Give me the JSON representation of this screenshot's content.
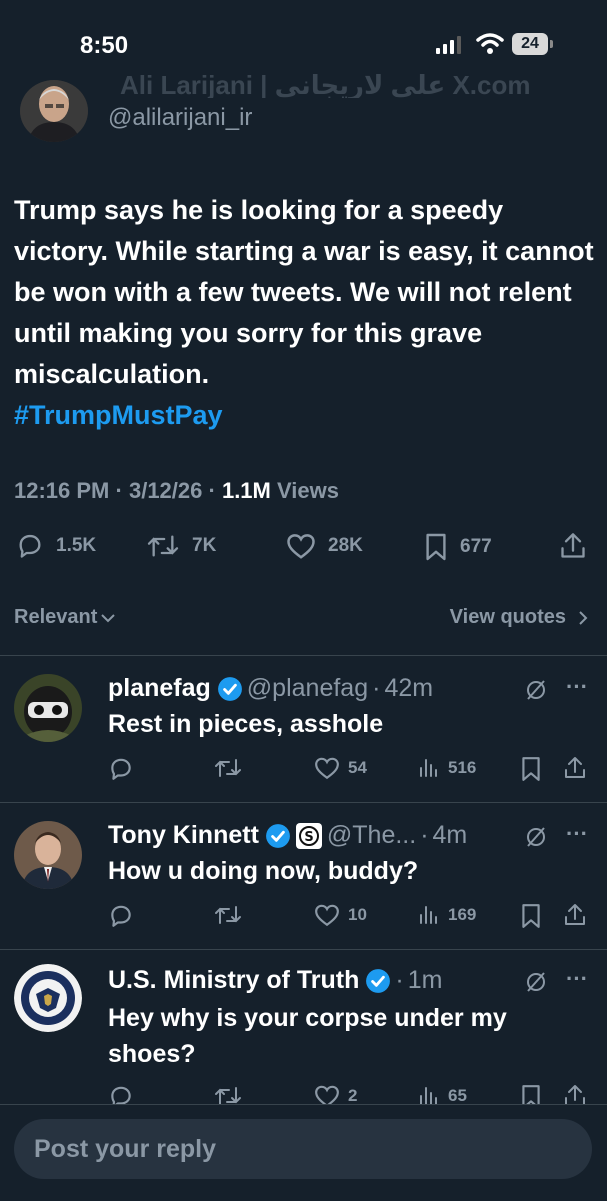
{
  "status_bar": {
    "time": "8:50",
    "battery": "24"
  },
  "header": {
    "ghost_text": "Ali Larijani | علی لاریجانی    X.com"
  },
  "tweet": {
    "handle": "@alilarijani_ir",
    "text": "Trump says he is looking for a speedy victory. While starting a war is easy, it cannot be won with a few tweets. We will not relent until making you sorry for this grave miscalculation.",
    "hashtag": "#TrumpMustPay",
    "time": "12:16 PM",
    "date": "3/12/26",
    "views_count": "1.1M",
    "views_label": "Views",
    "replies": "1.5K",
    "reposts": "7K",
    "likes": "28K",
    "bookmarks": "677"
  },
  "sort": {
    "relevant_label": "Relevant",
    "view_quotes_label": "View quotes"
  },
  "replies": [
    {
      "name": "planefag",
      "handle": "@planefag",
      "time": "42m",
      "text": "Rest in pieces, asshole",
      "replies": "",
      "reposts": "",
      "likes": "54",
      "views": "516"
    },
    {
      "name": "Tony Kinnett",
      "handle": "@The...",
      "time": "4m",
      "text": "How u doing now, buddy?",
      "replies": "",
      "reposts": "",
      "likes": "10",
      "views": "169"
    },
    {
      "name": "U.S. Ministry of Truth",
      "handle": "",
      "time": "1m",
      "text": "Hey why is your corpse under my shoes?",
      "replies": "",
      "reposts": "",
      "likes": "2",
      "views": "65"
    }
  ],
  "compose": {
    "placeholder": "Post your reply"
  },
  "colors": {
    "background": "#15202b",
    "accent": "#1d9bf0",
    "muted": "#8b98a5",
    "divider": "#38444d"
  },
  "icons": [
    "signal-icon",
    "wifi-icon",
    "reply-icon",
    "repost-icon",
    "like-icon",
    "bookmark-icon",
    "share-icon",
    "views-icon",
    "chevron-down-icon",
    "chevron-right-icon",
    "verified-icon",
    "grok-icon",
    "more-icon"
  ]
}
